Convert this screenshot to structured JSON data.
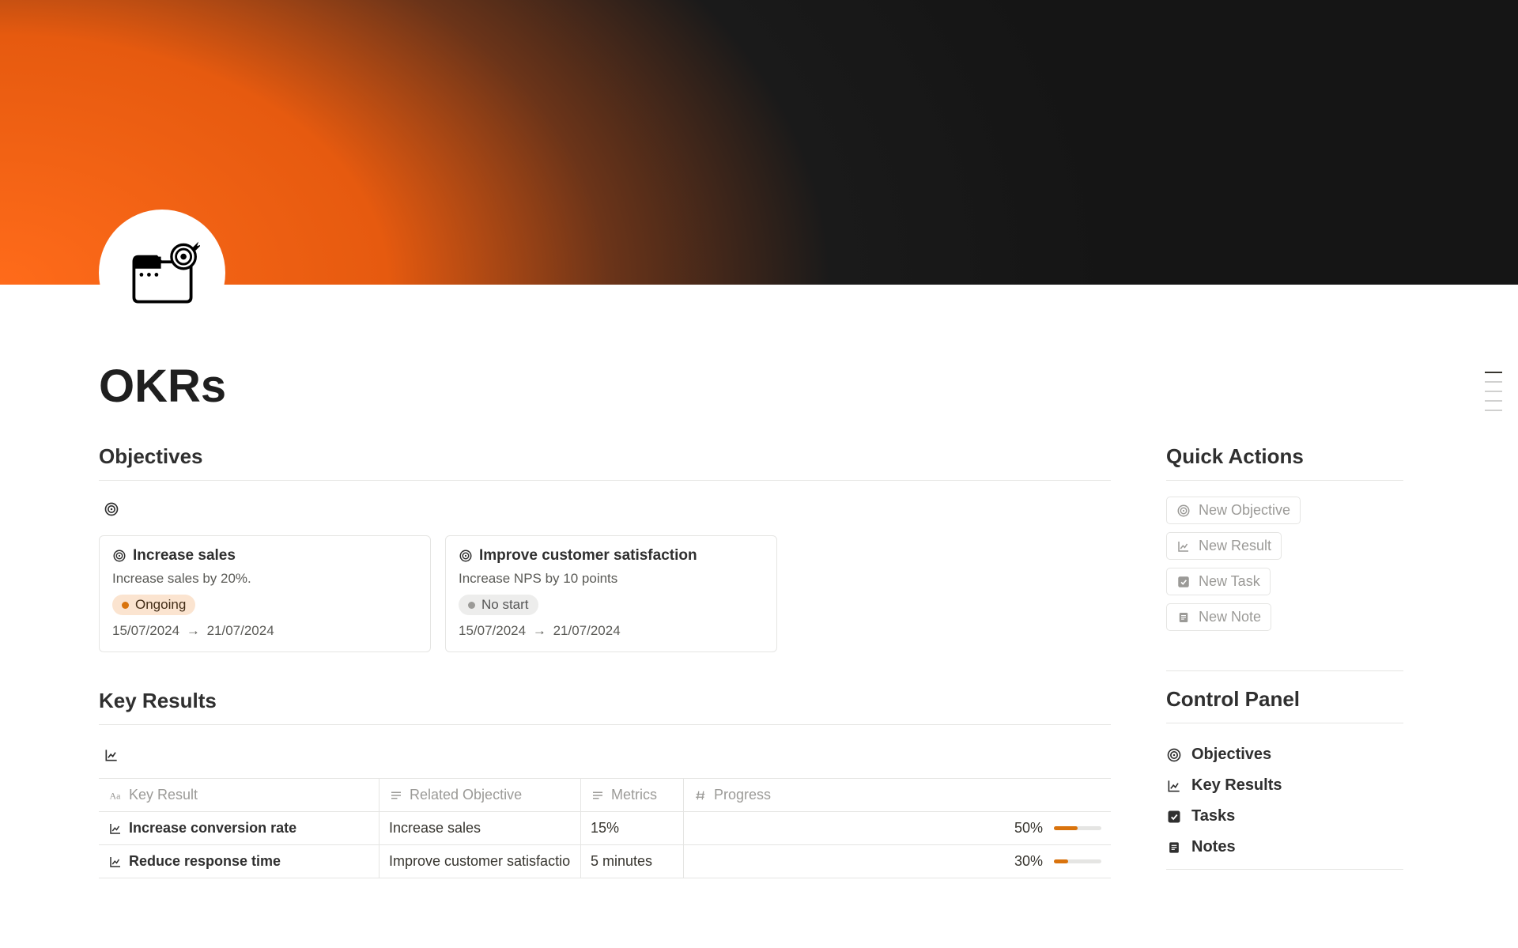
{
  "page": {
    "title": "OKRs"
  },
  "objectives": {
    "heading": "Objectives",
    "cards": [
      {
        "title": "Increase sales",
        "description": "Increase sales by 20%.",
        "status_label": "Ongoing",
        "status_kind": "ongoing",
        "date_start": "15/07/2024",
        "date_end": "21/07/2024"
      },
      {
        "title": "Improve customer satisfaction",
        "description": "Increase NPS by 10 points",
        "status_label": "No start",
        "status_kind": "nostart",
        "date_start": "15/07/2024",
        "date_end": "21/07/2024"
      }
    ]
  },
  "key_results": {
    "heading": "Key Results",
    "columns": {
      "key_result": "Key Result",
      "related_objective": "Related Objective",
      "metrics": "Metrics",
      "progress": "Progress"
    },
    "rows": [
      {
        "name": "Increase conversion rate",
        "objective": "Increase sales",
        "metrics": "15%",
        "progress_label": "50%",
        "progress_value": 50
      },
      {
        "name": "Reduce response time",
        "objective": "Improve customer satisfactio",
        "metrics": "5 minutes",
        "progress_label": "30%",
        "progress_value": 30
      }
    ]
  },
  "quick_actions": {
    "heading": "Quick Actions",
    "items": [
      {
        "label": "New Objective",
        "icon": "target"
      },
      {
        "label": "New Result",
        "icon": "chart"
      },
      {
        "label": "New Task",
        "icon": "check"
      },
      {
        "label": "New Note",
        "icon": "note"
      }
    ]
  },
  "control_panel": {
    "heading": "Control Panel",
    "items": [
      {
        "label": "Objectives",
        "icon": "target"
      },
      {
        "label": "Key Results",
        "icon": "chart"
      },
      {
        "label": "Tasks",
        "icon": "check"
      },
      {
        "label": "Notes",
        "icon": "note"
      }
    ]
  }
}
